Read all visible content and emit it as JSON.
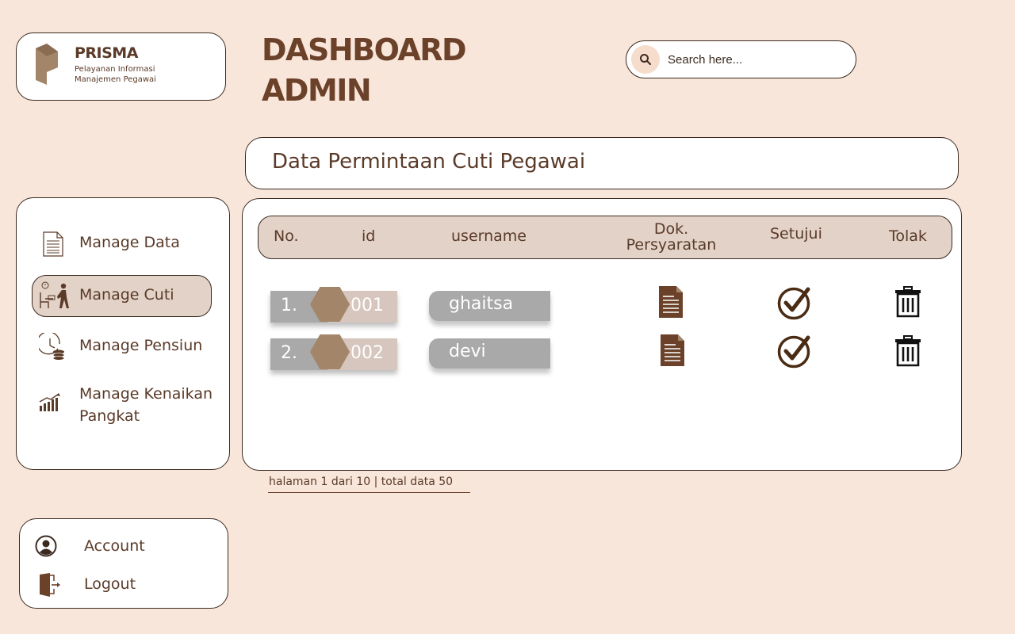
{
  "brand": {
    "name": "PRISMA",
    "tagline_line1": "Pelayanan Informasi",
    "tagline_line2": "Manajemen Pegawai",
    "color": "#a3856a"
  },
  "header": {
    "title": "DASHBOARD\nADMIN"
  },
  "search": {
    "placeholder": "Search here..."
  },
  "section": {
    "title": "Data Permintaan Cuti Pegawai"
  },
  "sidebar": {
    "items": [
      {
        "label": "Manage Data",
        "icon": "document-list-icon",
        "active": false
      },
      {
        "label": "Manage Cuti",
        "icon": "leave-walking-icon",
        "active": true
      },
      {
        "label": "Manage Pensiun",
        "icon": "clock-coins-icon",
        "active": false
      },
      {
        "label": "Manage Kenaikan\nPangkat",
        "icon": "growth-chart-icon",
        "active": false
      }
    ]
  },
  "account_menu": {
    "account": "Account",
    "logout": "Logout"
  },
  "table": {
    "headers": {
      "no": "No.",
      "id": "id",
      "username": "username",
      "dok": "Dok.\nPersyaratan",
      "setujui": "Setujui",
      "tolak": "Tolak"
    },
    "rows": [
      {
        "no": "1.",
        "id": "001",
        "username": "ghaitsa"
      },
      {
        "no": "2.",
        "id": "002",
        "username": "devi"
      }
    ]
  },
  "pagination": {
    "text": "halaman 1 dari 10 | total data 50"
  },
  "colors": {
    "background": "#f9e6da",
    "accent_brown": "#6b412a",
    "active_bg": "#e3d2c8"
  }
}
